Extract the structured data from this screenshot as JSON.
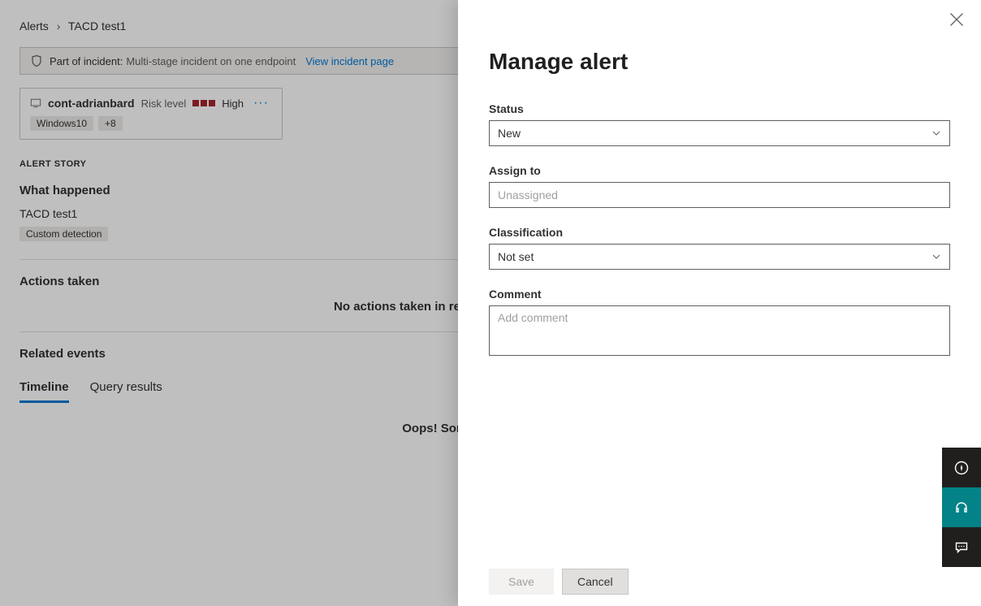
{
  "breadcrumb": {
    "root": "Alerts",
    "leaf": "TACD test1"
  },
  "incident_banner": {
    "label": "Part of incident:",
    "desc": "Multi-stage incident on one endpoint",
    "link": "View incident page"
  },
  "device": {
    "name": "cont-adrianbard",
    "risk_label": "Risk level",
    "risk_text": "High",
    "tags": [
      "Windows10",
      "+8"
    ]
  },
  "sections": {
    "alert_story": "ALERT STORY",
    "what_happened": "What happened",
    "alert_title": "TACD test1",
    "detection_tag": "Custom detection",
    "actions_taken": "Actions taken",
    "no_actions": "No actions taken in response to this custom detection",
    "related_events": "Related events",
    "tabs": {
      "timeline": "Timeline",
      "query": "Query results"
    },
    "error": "Oops! Something went wrong!"
  },
  "panel": {
    "title": "Manage alert",
    "status": {
      "label": "Status",
      "value": "New"
    },
    "assign": {
      "label": "Assign to",
      "placeholder": "Unassigned"
    },
    "classification": {
      "label": "Classification",
      "value": "Not set"
    },
    "comment": {
      "label": "Comment",
      "placeholder": "Add comment"
    },
    "buttons": {
      "save": "Save",
      "cancel": "Cancel"
    },
    "dock": {
      "gauge": "compass-icon",
      "headset": "headset-icon",
      "chat": "chat-icon"
    }
  }
}
